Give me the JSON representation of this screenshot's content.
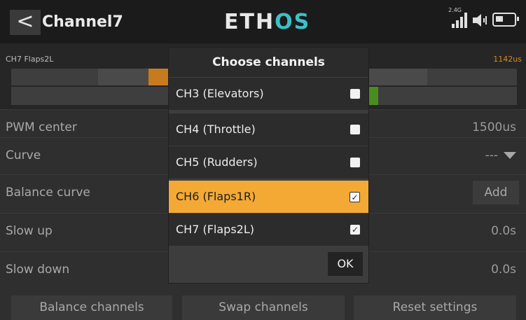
{
  "header": {
    "back_glyph": "<",
    "title": "Channel7",
    "logo_main": "ETH",
    "logo_accent": "OS",
    "signal_label": "2.4G",
    "icons": [
      "signal-bars-icon",
      "speaker-icon",
      "battery-icon"
    ]
  },
  "channel_monitor": {
    "label": "CH7  Flaps2L",
    "value": "1142us"
  },
  "rows": [
    {
      "label": "PWM center",
      "value": "1500us"
    },
    {
      "label": "Curve",
      "value": "---"
    },
    {
      "label": "Balance curve",
      "button": "Add"
    },
    {
      "label": "Slow up",
      "value": "0.0s"
    },
    {
      "label": "Slow down",
      "value": "0.0s"
    }
  ],
  "footer": {
    "balance_channels": "Balance channels",
    "swap_channels": "Swap channels",
    "reset_settings": "Reset settings"
  },
  "dialog": {
    "title": "Choose channels",
    "options": [
      {
        "label": "CH3 (Elevators)",
        "checked": false
      },
      {
        "label": "CH4 (Throttle)",
        "checked": false
      },
      {
        "label": "CH5 (Rudders)",
        "checked": false
      },
      {
        "label": "CH6 (Flaps1R)",
        "checked": true,
        "selected": true
      },
      {
        "label": "CH7 (Flaps2L)",
        "checked": true
      }
    ],
    "ok_label": "OK"
  },
  "colors": {
    "accent": "#f4a935",
    "logo_accent": "#3cc0c8",
    "monitor_orange": "#c87a1e",
    "monitor_green": "#4b8c1e"
  }
}
